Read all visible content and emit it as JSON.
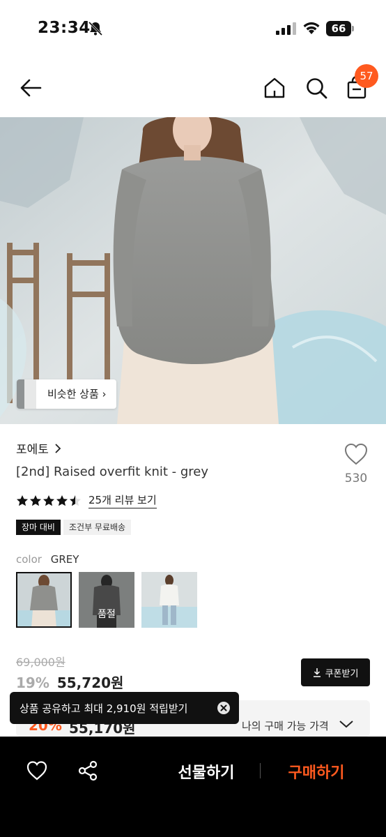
{
  "status": {
    "time": "23:34",
    "battery": "66"
  },
  "nav": {
    "cart_count": "57"
  },
  "hero": {
    "similar_label": "비슷한 상품"
  },
  "product": {
    "brand": "포에토",
    "name": "[2nd] Raised overfit knit - grey",
    "wish_count": "530",
    "rating": 4.5,
    "review_link": "25개 리뷰 보기",
    "tags": [
      "장마 대비",
      "조건부 무료배송"
    ],
    "color_label": "color",
    "color_value": "GREY",
    "soldout_label": "품절"
  },
  "price": {
    "original": "69,000원",
    "discount_pct": "19%",
    "sale": "55,720원",
    "coupon_label": "쿠폰받기",
    "my_pct": "20%",
    "my_price": "55,170원",
    "my_label": "나의 구매 가능 가격"
  },
  "toast": {
    "text": "상품 공유하고 최대 2,910원 적립받기"
  },
  "bottom": {
    "gift_label": "선물하기",
    "buy_label": "구매하기"
  },
  "colors": {
    "accent": "#ff5a1f",
    "dark": "#111111"
  }
}
